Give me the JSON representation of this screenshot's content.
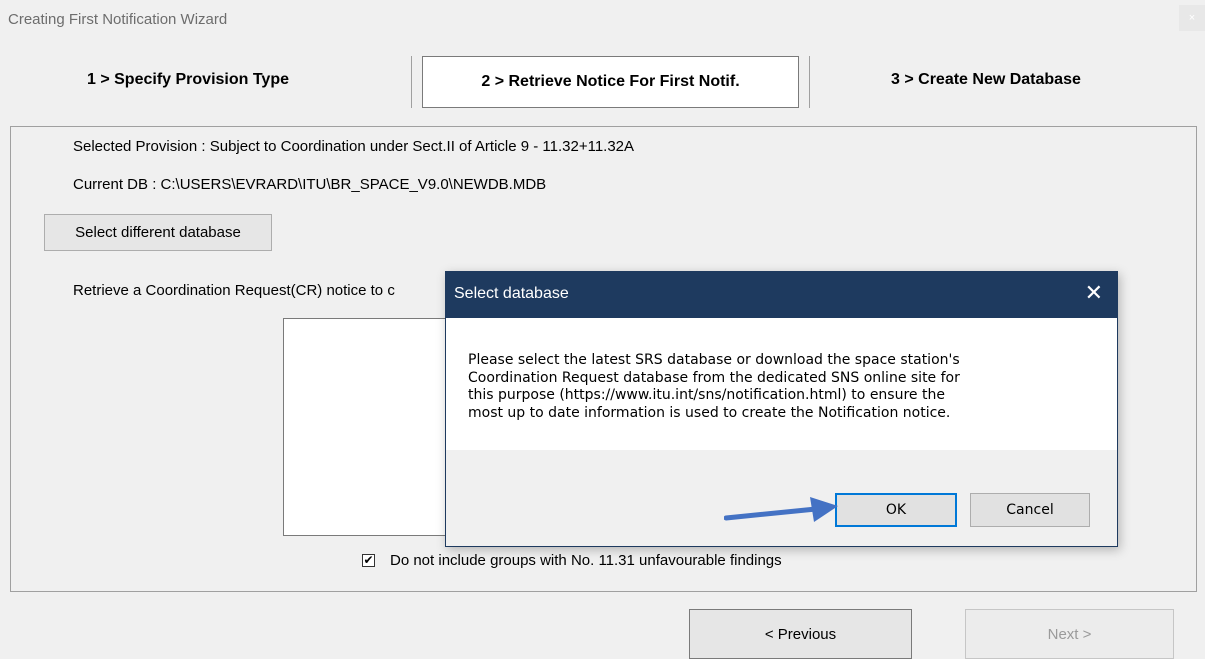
{
  "window": {
    "title": "Creating First Notification Wizard",
    "close_label": "×"
  },
  "steps": [
    {
      "label": "1 > Specify Provision Type"
    },
    {
      "label": "2 > Retrieve Notice For First Notif.",
      "active": true
    },
    {
      "label": "3 > Create New Database"
    }
  ],
  "panel": {
    "selected_provision": "Selected Provision : Subject to Coordination under Sect.II of Article 9 - 11.32+11.32A",
    "current_db": "Current DB : C:\\USERS\\EVRARD\\ITU\\BR_SPACE_V9.0\\NEWDB.MDB",
    "select_db_button": "Select different database",
    "retrieve_label": "Retrieve a Coordination Request(CR) notice to c",
    "checkbox_checked": true,
    "checkbox_mark": "✔",
    "checkbox_label": "Do not include groups with No. 11.31 unfavourable findings"
  },
  "nav": {
    "previous": "< Previous",
    "next": "Next >"
  },
  "dialog": {
    "title": "Select database",
    "close_label": "✕",
    "message_lines": [
      "Please select the latest SRS database or download the space station's",
      "Coordination Request database from the dedicated SNS online site for",
      "this purpose (https://www.itu.int/sns/notification.html) to ensure the",
      "most up to date information is used to create the Notification notice."
    ],
    "ok": "OK",
    "cancel": "Cancel"
  },
  "colors": {
    "dialog_titlebar": "#1e3a5f",
    "arrow": "#4472c4",
    "focus_border": "#0078d7"
  },
  "icons": {
    "arrow": "right-arrow-icon",
    "close": "close-icon"
  }
}
